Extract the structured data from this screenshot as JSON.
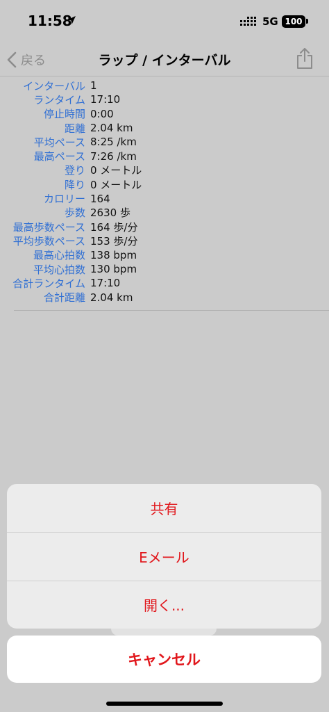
{
  "status_bar": {
    "time": "11:58",
    "network": "5G",
    "battery": "100",
    "icons": [
      "location-arrow-icon",
      "signal-bars-icon"
    ]
  },
  "nav": {
    "back_label": "戻る",
    "title": "ラップ / インターバル",
    "icons": [
      "chevron-left-icon",
      "share-icon"
    ]
  },
  "stats": [
    {
      "label": "インターバル",
      "value": "1"
    },
    {
      "label": "ランタイム",
      "value": "17:10"
    },
    {
      "label": "停止時間",
      "value": "0:00"
    },
    {
      "label": "距離",
      "value": "2.04 km"
    },
    {
      "label": "平均ペース",
      "value": "8:25 /km"
    },
    {
      "label": "最高ペース",
      "value": "7:26 /km"
    },
    {
      "label": "登り",
      "value": "0 メートル"
    },
    {
      "label": "降り",
      "value": "0 メートル"
    },
    {
      "label": "カロリー",
      "value": "164"
    },
    {
      "label": "歩数",
      "value": "2630 歩"
    },
    {
      "label": "最高歩数ペース",
      "value": "164 歩/分"
    },
    {
      "label": "平均歩数ペース",
      "value": "153 歩/分"
    },
    {
      "label": "最高心拍数",
      "value": "138 bpm"
    },
    {
      "label": "平均心拍数",
      "value": "130 bpm"
    },
    {
      "label": "合計ランタイム",
      "value": "17:10"
    },
    {
      "label": "合計距離",
      "value": "2.04 km"
    }
  ],
  "action_sheet": {
    "items": [
      {
        "label": "共有"
      },
      {
        "label": "Eメール"
      },
      {
        "label": "開く..."
      }
    ],
    "cancel_label": "キャンセル"
  },
  "colors": {
    "background": "#cbcbcb",
    "label_blue": "#2f6fd4",
    "action_red": "#e1161b",
    "sheet_bg": "#ececec"
  }
}
